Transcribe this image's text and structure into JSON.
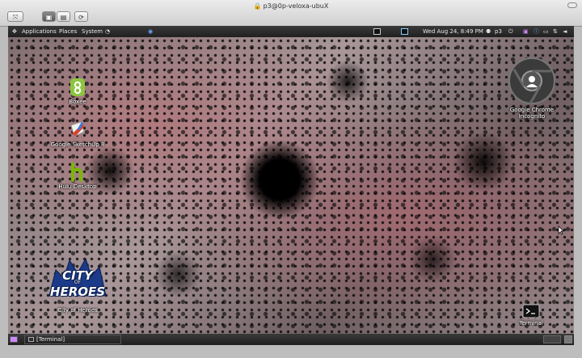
{
  "window": {
    "title": "p3@0p-veloxa-ubuX"
  },
  "panel": {
    "menus": [
      "Applications",
      "Places",
      "System"
    ],
    "datetime": "Wed Aug 24,  8:49 PM",
    "user": "p3"
  },
  "desktop": {
    "icons": {
      "boxee": "Boxee",
      "sketchup": "Google SketchUp 8",
      "hulu": "Hulu Desktop",
      "cityofheroes": "City of Heroes",
      "chrome": "Google Chrome\nIncognito",
      "terminal": "Terminal"
    },
    "coh_logo_text": [
      "CITY",
      "OF",
      "HEROES"
    ]
  },
  "taskbar": {
    "task": "[Terminal]"
  },
  "colors": {
    "boxee": "#8cc63f",
    "hulu": "#7ab800",
    "panel": "#2a2a2a"
  }
}
